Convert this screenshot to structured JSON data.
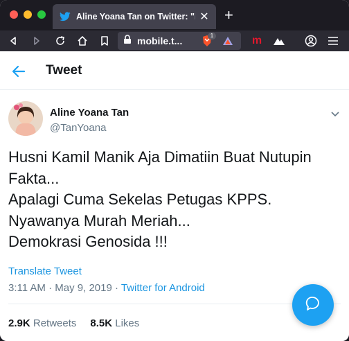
{
  "browser": {
    "tab_title": "Aline Yoana Tan on Twitter: \"Husni Kamil Manik Aja Dimatiin Buat Nutupin Fakta...",
    "tab_close": "✕",
    "new_tab": "+",
    "url": "mobile.t...",
    "brave_count": "1",
    "extension_m": "m"
  },
  "header": {
    "title": "Tweet"
  },
  "tweet": {
    "author_name": "Aline Yoana Tan",
    "author_handle": "@TanYoana",
    "lines": [
      "Husni Kamil Manik Aja Dimatiin Buat Nutupin",
      "Fakta...",
      "Apalagi Cuma Sekelas Petugas KPPS.",
      "Nyawanya Murah Meriah...",
      "Demokrasi Genosida !!!"
    ],
    "translate_label": "Translate Tweet",
    "time": "3:11 AM",
    "separator": " · ",
    "date": "May 9, 2019",
    "source": "Twitter for Android",
    "retweets_count": "2.9K",
    "retweets_label": "Retweets",
    "likes_count": "8.5K",
    "likes_label": "Likes"
  },
  "colors": {
    "accent": "#1da1f2",
    "link": "#1b95e0",
    "text": "#14171a",
    "muted": "#657786"
  }
}
